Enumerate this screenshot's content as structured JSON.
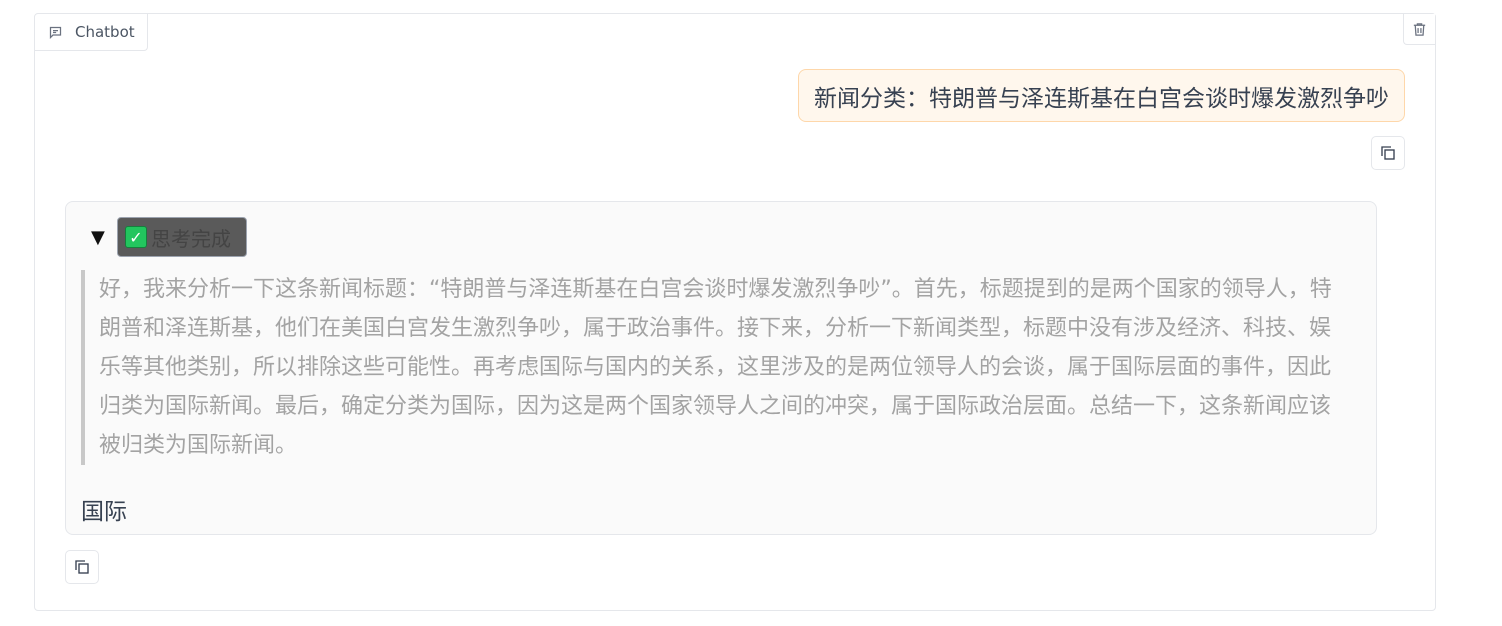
{
  "chatbot": {
    "label": "Chatbot",
    "icons": {
      "label": "chat-icon",
      "clear": "trash-icon",
      "copy": "copy-icon",
      "toggle": "triangle-down-icon",
      "status": "check-box-icon"
    }
  },
  "messages": {
    "user": {
      "text": "新闻分类：特朗普与泽连斯基在白宫会谈时爆发激烈争吵"
    },
    "bot": {
      "thinking_status": "思考完成",
      "thinking_text": "好，我来分析一下这条新闻标题：“特朗普与泽连斯基在白宫会谈时爆发激烈争吵”。首先，标题提到的是两个国家的领导人，特朗普和泽连斯基，他们在美国白宫发生激烈争吵，属于政治事件。接下来，分析一下新闻类型，标题中没有涉及经济、科技、娱乐等其他类别，所以排除这些可能性。再考虑国际与国内的关系，这里涉及的是两位领导人的会谈，属于国际层面的事件，因此归类为国际新闻。最后，确定分类为国际，因为这是两个国家领导人之间的冲突，属于国际政治层面。总结一下，这条新闻应该被归类为国际新闻。",
      "answer": "国际"
    }
  },
  "colors": {
    "user_bubble_bg": "#fff7ed",
    "user_bubble_border": "#fed7aa",
    "bot_bubble_bg": "#fafafa",
    "thinking_text": "#a3a3a3",
    "check_green": "#22c55e"
  }
}
